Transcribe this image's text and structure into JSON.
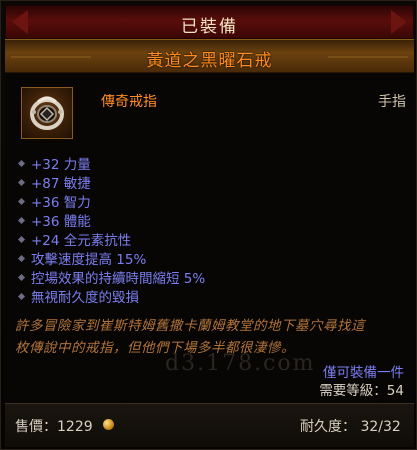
{
  "header": {
    "equipped_label": "已裝備"
  },
  "item": {
    "name": "黃道之黑曜石戒",
    "type": "傳奇戒指",
    "slot": "手指",
    "icon": "ring-icon",
    "name_color": "#ff8a1c",
    "stat_color": "#7b7ef0"
  },
  "stats": [
    "+32 力量",
    "+87 敏捷",
    "+36 智力",
    "+36 體能",
    "+24 全元素抗性",
    "攻擊速度提高 15%",
    "控場效果的持續時間縮短 5%",
    "無視耐久度的毀損"
  ],
  "flavor": [
    "許多冒險家到崔斯特姆舊撒卡蘭姆教堂的地下墓穴尋找這",
    "枚傳說中的戒指，但他們下場多半都很淒慘。"
  ],
  "watermark": "d3.178.com",
  "account_bound": "僅可裝備一件",
  "required_level": "需要等級：54",
  "footer": {
    "price": "售價：1229",
    "durability": "耐久度：   32/32"
  }
}
